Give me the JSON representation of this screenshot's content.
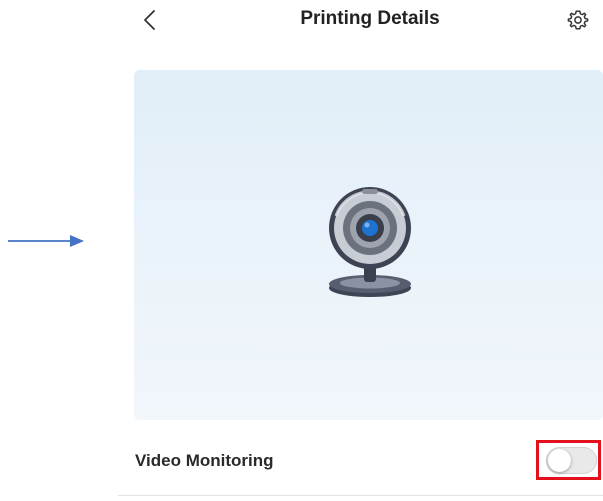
{
  "header": {
    "title": "Printing Details",
    "back_icon": "chevron-left-icon",
    "settings_icon": "gear-icon"
  },
  "annotation": {
    "arrow_icon": "arrow-right-icon",
    "arrow_color": "#4472c4",
    "highlight_color": "#e3111b"
  },
  "video_panel": {
    "placeholder_icon": "webcam-icon",
    "accent_color": "#1e73d2"
  },
  "settings_row": {
    "label": "Video Monitoring",
    "toggle_on": false
  }
}
